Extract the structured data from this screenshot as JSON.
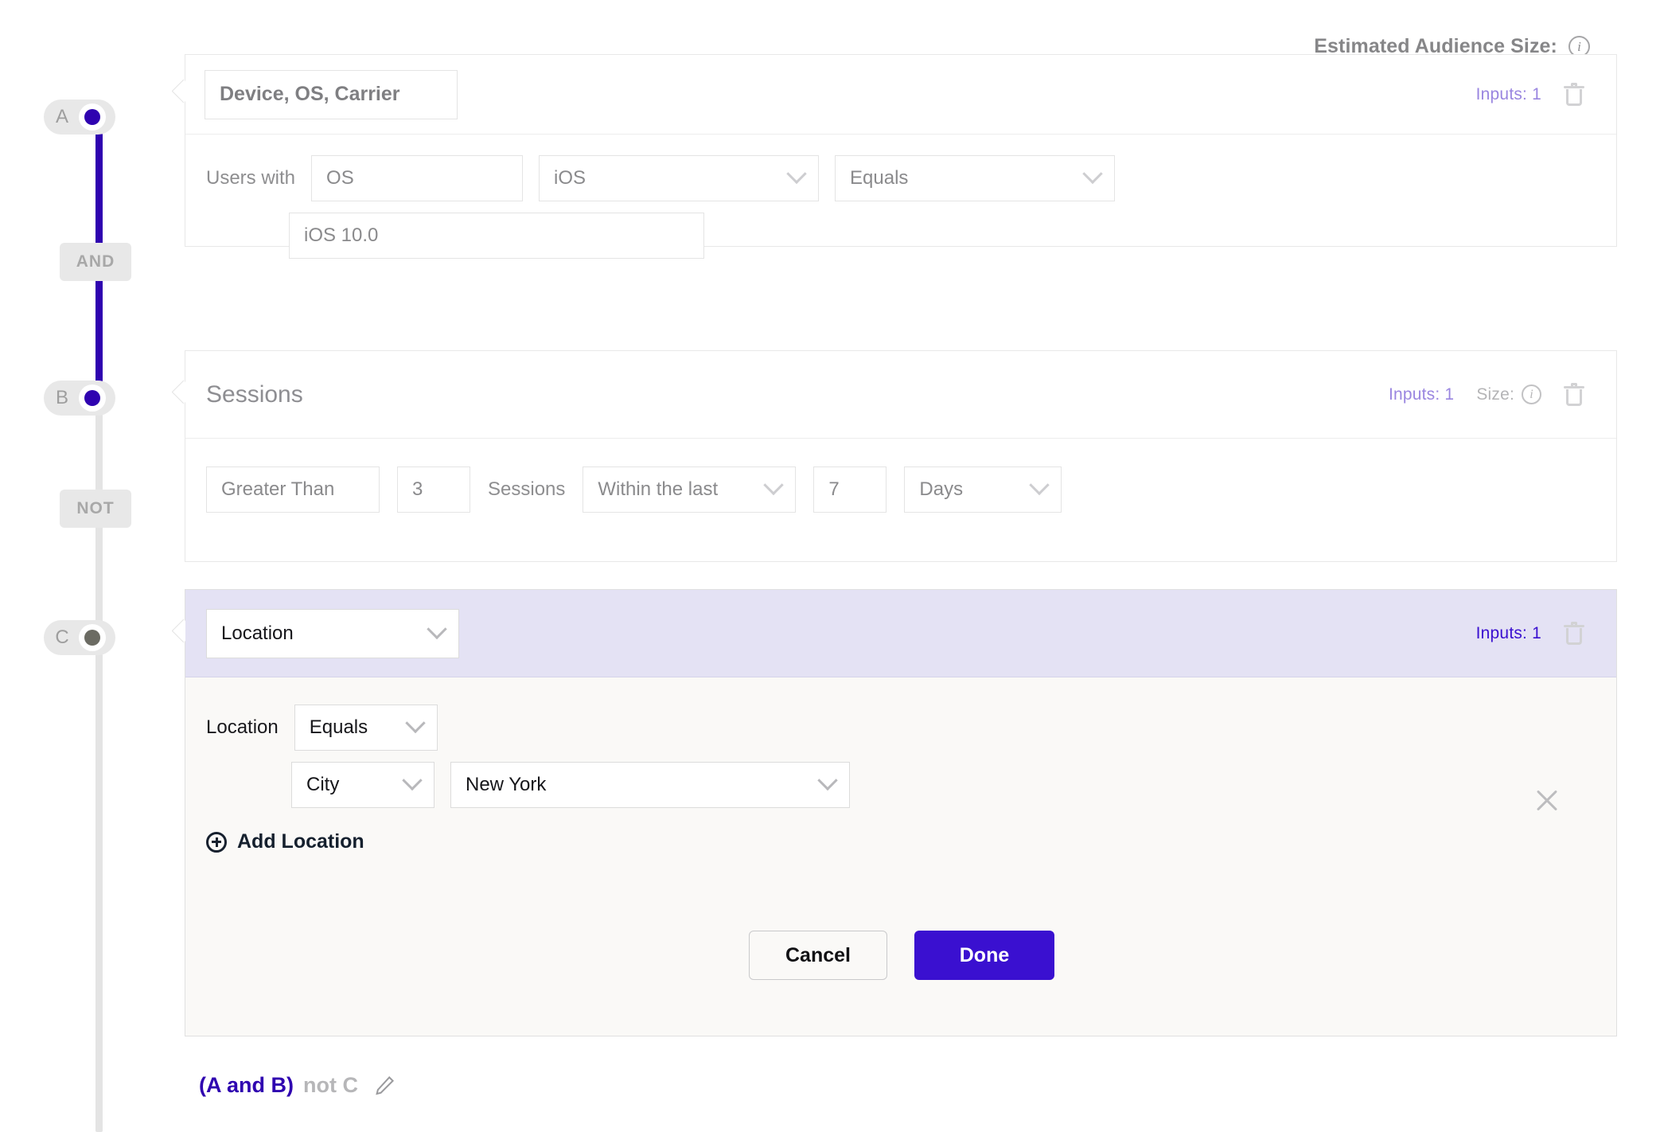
{
  "header": {
    "estimated_audience_label": "Estimated Audience Size:",
    "info_icon": "info-icon",
    "info_glyph": "i"
  },
  "rail": {
    "nodes": [
      {
        "letter": "A",
        "state": "active"
      },
      {
        "letter": "B",
        "state": "active"
      },
      {
        "letter": "C",
        "state": "inactive"
      }
    ],
    "operators": [
      {
        "label": "AND"
      },
      {
        "label": "NOT"
      }
    ]
  },
  "cards": [
    {
      "id": "A",
      "title": "Device, OS, Carrier",
      "inputs_label": "Inputs: 1",
      "delete_icon": "trash-icon",
      "prefix_label": "Users with",
      "property_value": "OS",
      "operand_value": "iOS",
      "operator_value": "Equals",
      "version_value": "iOS 10.0"
    },
    {
      "id": "B",
      "title": "Sessions",
      "inputs_label": "Inputs: 1",
      "size_label": "Size:",
      "size_info_glyph": "i",
      "delete_icon": "trash-icon",
      "comparator_value": "Greater Than",
      "count_value": "3",
      "unit_label": "Sessions",
      "window_value": "Within the last",
      "window_count_value": "7",
      "window_unit_value": "Days"
    },
    {
      "id": "C",
      "title": "Location",
      "inputs_label": "Inputs: 1",
      "delete_icon": "trash-icon",
      "row_label": "Location",
      "operator_value": "Equals",
      "scope_value": "City",
      "place_value": "New York",
      "add_label": "Add Location",
      "add_icon": "plus-circle-icon",
      "close_icon": "close-icon",
      "cancel_label": "Cancel",
      "done_label": "Done"
    }
  ],
  "formula": {
    "group": "(A and B)",
    "rest": "not C",
    "edit_icon": "pencil-icon"
  },
  "colors": {
    "accent": "#2f03b0",
    "primary_button": "#3a10d0",
    "inputs_muted": "#9a86e0",
    "highlight_header": "#e4e2f4",
    "panel_bg": "#faf9f7",
    "rail_inactive": "#e4e4e4",
    "dot_inactive": "#6b6b63"
  }
}
